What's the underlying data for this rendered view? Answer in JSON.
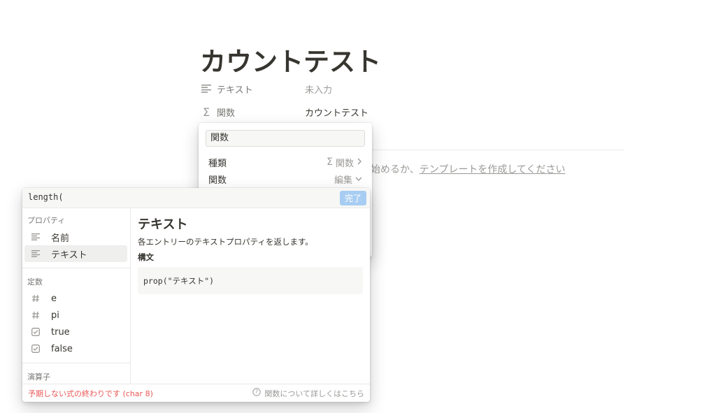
{
  "page": {
    "title": "カウントテスト",
    "properties": [
      {
        "icon": "text-lines-icon",
        "name": "テキスト",
        "value": "未入力"
      },
      {
        "icon": "sigma-icon",
        "name": "関数",
        "value": "カウントテスト"
      }
    ],
    "template_hint_prefix": "始めるか、",
    "template_hint_link": "テンプレートを作成してください"
  },
  "prop_menu": {
    "name_value": "関数",
    "type_label": "種類",
    "type_value": "関数",
    "formula_label": "関数",
    "formula_value": "編集"
  },
  "formula_editor": {
    "input_value": "length(",
    "done_label": "完了",
    "sections": {
      "properties_label": "プロパティ",
      "constants_label": "定数",
      "operators_label": "演算子"
    },
    "property_items": [
      {
        "label": "名前",
        "icon": "text-lines-icon"
      },
      {
        "label": "テキスト",
        "icon": "text-lines-icon",
        "selected": true
      }
    ],
    "constant_items": [
      {
        "label": "e",
        "icon": "hash-icon"
      },
      {
        "label": "pi",
        "icon": "hash-icon"
      },
      {
        "label": "true",
        "icon": "checkbox-icon"
      },
      {
        "label": "false",
        "icon": "checkbox-icon"
      }
    ],
    "detail": {
      "title": "テキスト",
      "description": "各エントリーのテキストプロパティを返します。",
      "syntax_label": "構文",
      "syntax_code": "prop(\"テキスト\")"
    },
    "error": "予期しない式の終わりです (char 8)",
    "help_link": "関数について詳しくはこちら"
  },
  "colors": {
    "accent_done": "#a8cdf2",
    "error": "#eb5757",
    "text": "#37352f",
    "muted": "#9b9a97"
  }
}
